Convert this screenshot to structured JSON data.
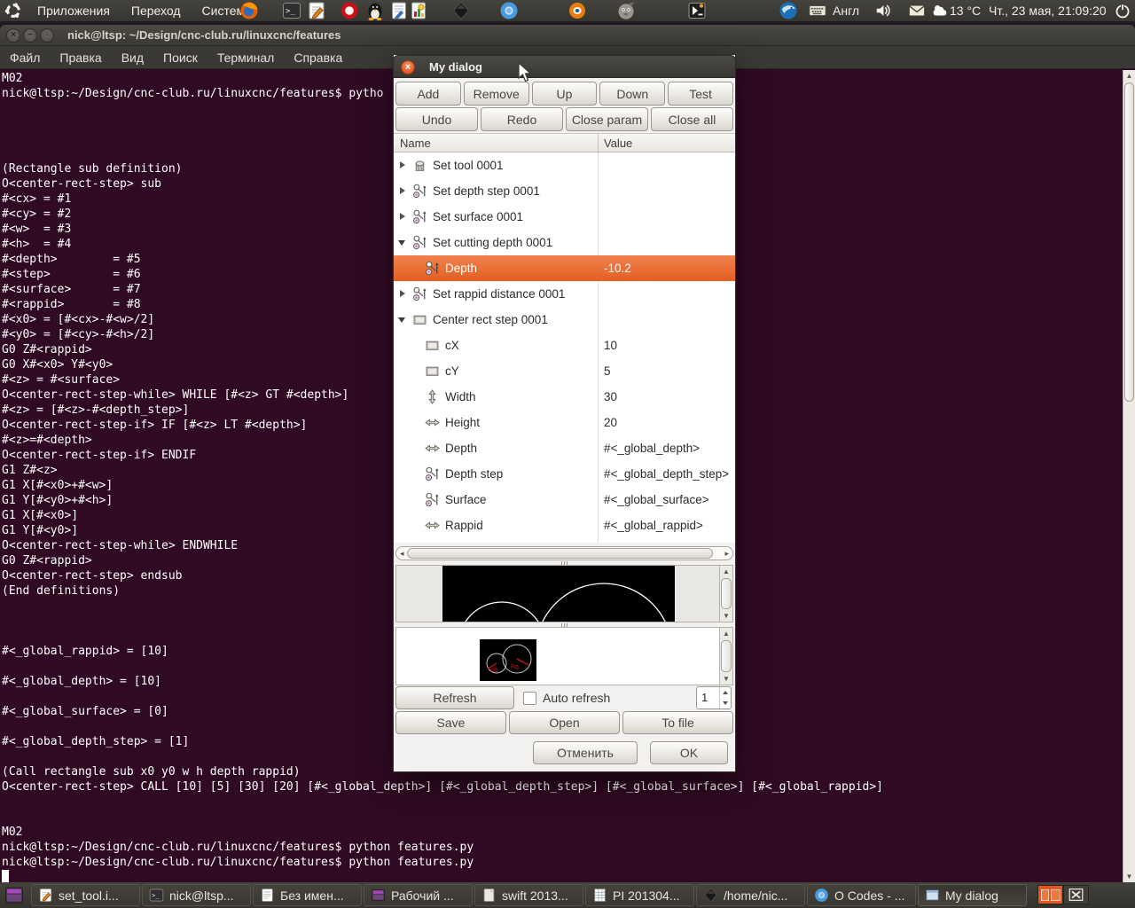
{
  "panel": {
    "menus": [
      "Приложения",
      "Переход",
      "Система"
    ],
    "launchers": [
      "firefox-icon",
      "terminal-icon",
      "gedit-icon",
      "opera-icon",
      "tux-icon",
      "writer-doc-icon",
      "impress-doc-icon",
      "inkscape-icon",
      "chromium-icon",
      "blender-icon",
      "gimp-icon",
      "remote-terminal-icon",
      "thunderbird-icon"
    ],
    "tray": {
      "layout": "Англ",
      "temperature": "13 °C",
      "clock": "Чт., 23 мая, 21:09:20"
    }
  },
  "terminal": {
    "title": "nick@ltsp: ~/Design/cnc-club.ru/linuxcnc/features",
    "menu": [
      "Файл",
      "Правка",
      "Вид",
      "Поиск",
      "Терминал",
      "Справка"
    ],
    "lines": [
      "M02",
      "nick@ltsp:~/Design/cnc-club.ru/linuxcnc/features$ pytho",
      "",
      "",
      "",
      "",
      "(Rectangle sub definition)",
      "O<center-rect-step> sub",
      "#<cx> = #1",
      "#<cy> = #2",
      "#<w>  = #3",
      "#<h>  = #4",
      "#<depth>        = #5",
      "#<step>         = #6",
      "#<surface>      = #7",
      "#<rappid>       = #8",
      "#<x0> = [#<cx>-#<w>/2]",
      "#<y0> = [#<cy>-#<h>/2]",
      "G0 Z#<rappid>",
      "G0 X#<x0> Y#<y0>",
      "#<z> = #<surface>",
      "O<center-rect-step-while> WHILE [#<z> GT #<depth>]",
      "#<z> = [#<z>-#<depth_step>]",
      "O<center-rect-step-if> IF [#<z> LT #<depth>]",
      "#<z>=#<depth>",
      "O<center-rect-step-if> ENDIF",
      "G1 Z#<z>",
      "G1 X[#<x0>+#<w>]",
      "G1 Y[#<y0>+#<h>]",
      "G1 X[#<x0>]",
      "G1 Y[#<y0>]",
      "O<center-rect-step-while> ENDWHILE",
      "G0 Z#<rappid>",
      "O<center-rect-step> endsub",
      "(End definitions)",
      "",
      "",
      "",
      "#<_global_rappid> = [10]",
      "",
      "#<_global_depth> = [10]",
      "",
      "#<_global_surface> = [0]",
      "",
      "#<_global_depth_step> = [1]",
      "",
      "(Call rectangle sub x0 y0 w h depth rappid)",
      "O<center-rect-step> CALL [10] [5] [30] [20] [#<_global_depth>] [#<_global_depth_step>] [#<_global_surface>] [#<_global_rappid>]",
      "",
      "",
      "M02",
      "nick@ltsp:~/Design/cnc-club.ru/linuxcnc/features$ python features.py",
      "nick@ltsp:~/Design/cnc-club.ru/linuxcnc/features$ python features.py",
      ""
    ]
  },
  "dialog": {
    "title": "My dialog",
    "toolbar_row1": [
      "Add",
      "Remove",
      "Up",
      "Down",
      "Test"
    ],
    "toolbar_row2": [
      "Undo",
      "Redo",
      "Close param",
      "Close all"
    ],
    "columns": [
      "Name",
      "Value"
    ],
    "tree": [
      {
        "label": "Set tool 0001",
        "value": "",
        "icon": "tool-icon",
        "expander": "collapsed",
        "level": 0,
        "selected": false
      },
      {
        "label": "Set depth step 0001",
        "value": "",
        "icon": "measure-icon",
        "expander": "collapsed",
        "level": 0,
        "selected": false
      },
      {
        "label": "Set surface 0001",
        "value": "",
        "icon": "measure-icon",
        "expander": "collapsed",
        "level": 0,
        "selected": false
      },
      {
        "label": "Set cutting depth 0001",
        "value": "",
        "icon": "measure-icon",
        "expander": "expanded",
        "level": 0,
        "selected": false
      },
      {
        "label": "Depth",
        "value": "-10.2",
        "icon": "measure-icon",
        "expander": "none",
        "level": 1,
        "selected": true
      },
      {
        "label": "Set rappid distance 0001",
        "value": "",
        "icon": "measure-icon",
        "expander": "collapsed",
        "level": 0,
        "selected": false
      },
      {
        "label": "Center rect step 0001",
        "value": "",
        "icon": "rect-icon",
        "expander": "expanded",
        "level": 0,
        "selected": false
      },
      {
        "label": "cX",
        "value": "10",
        "icon": "rect-icon",
        "expander": "none",
        "level": 1,
        "selected": false
      },
      {
        "label": "cY",
        "value": "5",
        "icon": "rect-icon",
        "expander": "none",
        "level": 1,
        "selected": false
      },
      {
        "label": "Width",
        "value": "30",
        "icon": "v-arrow-icon",
        "expander": "none",
        "level": 1,
        "selected": false
      },
      {
        "label": "Height",
        "value": "20",
        "icon": "h-arrow-icon",
        "expander": "none",
        "level": 1,
        "selected": false
      },
      {
        "label": "Depth",
        "value": "#<_global_depth>",
        "icon": "h-arrow-icon",
        "expander": "none",
        "level": 1,
        "selected": false
      },
      {
        "label": "Depth step",
        "value": "#<_global_depth_step>",
        "icon": "measure-icon",
        "expander": "none",
        "level": 1,
        "selected": false
      },
      {
        "label": "Surface",
        "value": "#<_global_surface>",
        "icon": "measure-icon",
        "expander": "none",
        "level": 1,
        "selected": false
      },
      {
        "label": "Rappid",
        "value": "#<_global_rappid>",
        "icon": "h-arrow-icon",
        "expander": "none",
        "level": 1,
        "selected": false
      }
    ],
    "preview_labels": {
      "ra": "Ra",
      "rb": "Rb"
    },
    "controls": {
      "refresh": "Refresh",
      "auto_refresh": "Auto refresh",
      "interval_value": "1",
      "save": "Save",
      "open": "Open",
      "to_file": "To file",
      "cancel": "Отменить",
      "ok": "OK"
    }
  },
  "taskbar": {
    "items": [
      {
        "label": "set_tool.i...",
        "icon": "gedit-icon",
        "active": false
      },
      {
        "label": "nick@ltsp...",
        "icon": "terminal-icon",
        "active": false
      },
      {
        "label": "Без имен...",
        "icon": "text-doc-icon",
        "active": false
      },
      {
        "label": "Рабочий ...",
        "icon": "window-list-icon",
        "active": false
      },
      {
        "label": "swift 2013...",
        "icon": "plain-doc-icon",
        "active": false
      },
      {
        "label": "PI 201304...",
        "icon": "spreadsheet-icon",
        "active": false
      },
      {
        "label": "/home/nic...",
        "icon": "inkscape-icon",
        "active": false
      },
      {
        "label": "O Codes - ...",
        "icon": "chromium-icon",
        "active": false
      },
      {
        "label": "My dialog",
        "icon": "window-icon",
        "active": true
      }
    ]
  },
  "icons": {
    "ubuntu-logo-icon": "circle-of-friends ring",
    "firefox-icon": "orange browser ball",
    "terminal-icon": "dark terminal prompt",
    "gedit-icon": "page with pencil",
    "opera-icon": "red O ring",
    "tux-icon": "penguin",
    "writer-doc-icon": "document with pencil",
    "impress-doc-icon": "document with chart",
    "inkscape-icon": "black diamond",
    "chromium-icon": "blue sphere",
    "blender-icon": "orange sphere",
    "gimp-icon": "gray mascot",
    "remote-terminal-icon": "dark box with arrow",
    "thunderbird-icon": "blue bird ball",
    "keyboard-icon": "keyboard",
    "volume-icon": "speaker",
    "mail-icon": "envelope",
    "weather-icon": "cloud",
    "power-icon": "power symbol",
    "window-close-icon": "x circle",
    "window-min-icon": "minus circle",
    "window-max-icon": "square circle",
    "dialog-close-icon": "orange x circle",
    "tool-icon": "milling tool cylinder",
    "measure-icon": "two circles with measure line",
    "rect-icon": "rectangle outline",
    "v-arrow-icon": "vertical double arrow",
    "h-arrow-icon": "horizontal double arrow",
    "text-doc-icon": "text document",
    "plain-doc-icon": "plain document",
    "spreadsheet-icon": "grid document",
    "window-list-icon": "purple window",
    "window-icon": "blue window",
    "workspace-x-icon": "window with x"
  },
  "colors": {
    "accent_orange": "#E95420",
    "selection_orange": "#E4601F",
    "terminal_background": "#300A24",
    "panel_background": "#3C3B37",
    "dialog_background": "#F2F1EF"
  }
}
